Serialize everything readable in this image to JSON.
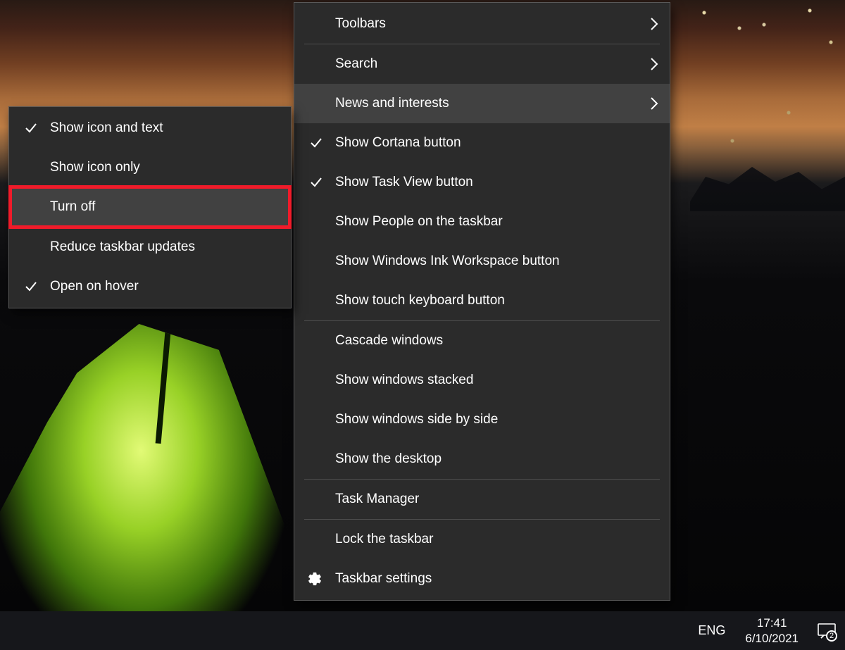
{
  "main_menu": {
    "items": [
      {
        "label": "Toolbars",
        "submenu": true,
        "checked": false,
        "hover": false,
        "sep_after": true
      },
      {
        "label": "Search",
        "submenu": true,
        "checked": false,
        "hover": false,
        "sep_after": false
      },
      {
        "label": "News and interests",
        "submenu": true,
        "checked": false,
        "hover": true,
        "sep_after": false
      },
      {
        "label": "Show Cortana button",
        "submenu": false,
        "checked": true,
        "hover": false,
        "sep_after": false
      },
      {
        "label": "Show Task View button",
        "submenu": false,
        "checked": true,
        "hover": false,
        "sep_after": false
      },
      {
        "label": "Show People on the taskbar",
        "submenu": false,
        "checked": false,
        "hover": false,
        "sep_after": false
      },
      {
        "label": "Show Windows Ink Workspace button",
        "submenu": false,
        "checked": false,
        "hover": false,
        "sep_after": false
      },
      {
        "label": "Show touch keyboard button",
        "submenu": false,
        "checked": false,
        "hover": false,
        "sep_after": true
      },
      {
        "label": "Cascade windows",
        "submenu": false,
        "checked": false,
        "hover": false,
        "sep_after": false
      },
      {
        "label": "Show windows stacked",
        "submenu": false,
        "checked": false,
        "hover": false,
        "sep_after": false
      },
      {
        "label": "Show windows side by side",
        "submenu": false,
        "checked": false,
        "hover": false,
        "sep_after": false
      },
      {
        "label": "Show the desktop",
        "submenu": false,
        "checked": false,
        "hover": false,
        "sep_after": true
      },
      {
        "label": "Task Manager",
        "submenu": false,
        "checked": false,
        "hover": false,
        "sep_after": true
      },
      {
        "label": "Lock the taskbar",
        "submenu": false,
        "checked": false,
        "hover": false,
        "sep_after": false
      },
      {
        "label": "Taskbar settings",
        "submenu": false,
        "checked": false,
        "hover": false,
        "icon": "gear"
      }
    ]
  },
  "sub_menu": {
    "items": [
      {
        "label": "Show icon and text",
        "checked": true,
        "hover": false,
        "sep_after": false
      },
      {
        "label": "Show icon only",
        "checked": false,
        "hover": false,
        "sep_after": false
      },
      {
        "label": "Turn off",
        "checked": false,
        "hover": true,
        "sep_after": true,
        "highlight": true
      },
      {
        "label": "Reduce taskbar updates",
        "checked": false,
        "hover": false,
        "sep_after": false
      },
      {
        "label": "Open on hover",
        "checked": true,
        "hover": false,
        "sep_after": false
      }
    ]
  },
  "taskbar": {
    "language": "ENG",
    "time": "17:41",
    "date": "6/10/2021",
    "notification_count": "2"
  }
}
